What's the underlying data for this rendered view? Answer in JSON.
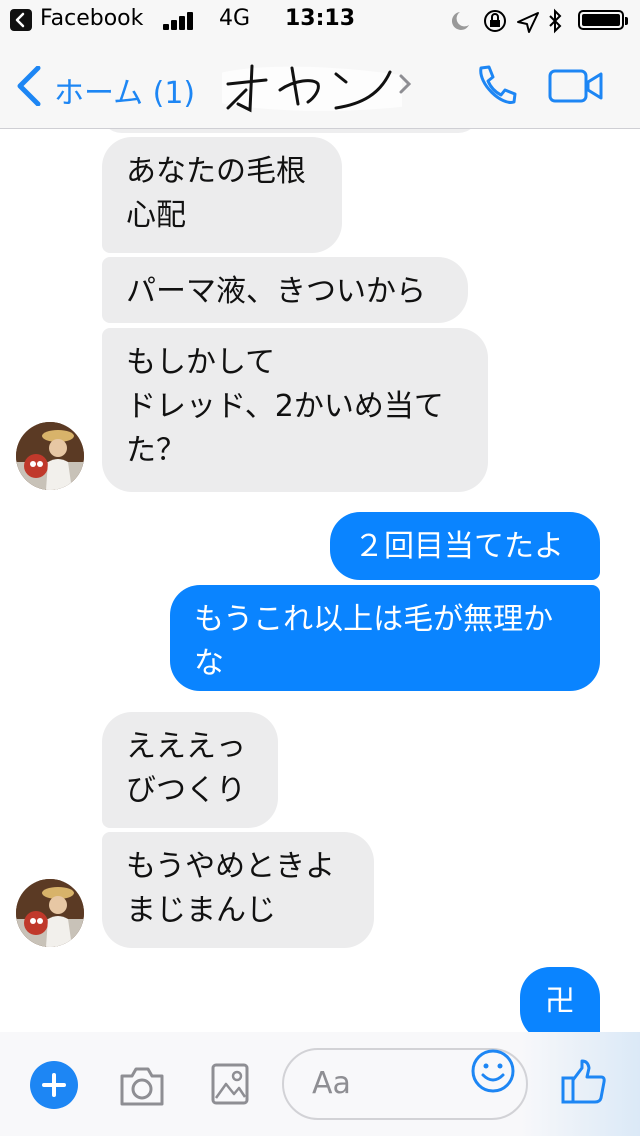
{
  "status_bar": {
    "app": "Facebook",
    "network": "4G",
    "time": "13:13"
  },
  "nav": {
    "back_label": "ホーム (1)",
    "title": "オヤン"
  },
  "messages": [
    {
      "side": "in",
      "text": "あなたの毛根\n心配"
    },
    {
      "side": "in",
      "text": "パーマ液、きついから"
    },
    {
      "side": "in",
      "text": "もしかして\nドレッド、2かいめ当て\nた？"
    },
    {
      "side": "out",
      "text": "２回目当てたよ"
    },
    {
      "side": "out",
      "text": "もうこれ以上は毛が無理か\nな"
    },
    {
      "side": "in",
      "text": "えええっ\nびつくり"
    },
    {
      "side": "in",
      "text": "もうやめときよ\nまじまんじ"
    },
    {
      "side": "out",
      "text": "卍"
    }
  ],
  "composer": {
    "placeholder": "Aa"
  },
  "colors": {
    "accent": "#1d86f4",
    "outgoing_bubble": "#0a84ff",
    "incoming_bubble": "#ececed"
  },
  "icons": [
    "back-chevron-icon",
    "phone-icon",
    "video-camera-icon",
    "plus-icon",
    "camera-icon",
    "image-icon",
    "emoji-icon",
    "thumbs-up-icon"
  ]
}
